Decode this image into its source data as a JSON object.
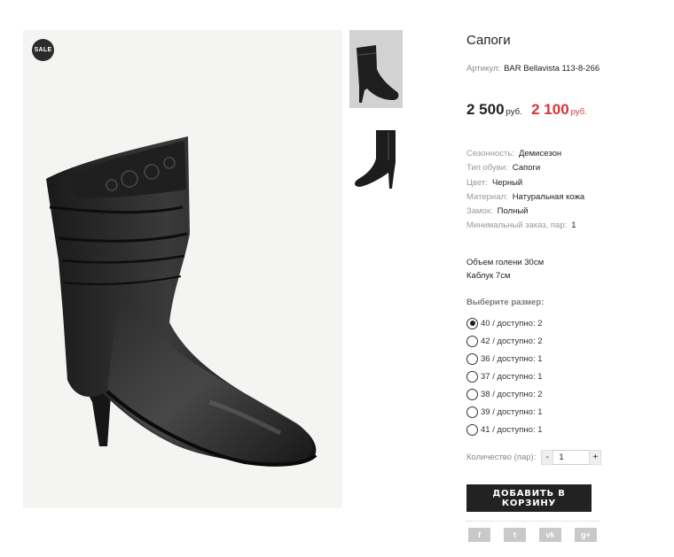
{
  "product": {
    "sale_badge": "SALE",
    "title": "Сапоги",
    "sku_label": "Артикул:",
    "sku_value": "BAR Bellavista 113-8-266",
    "price_old": "2 500",
    "price_old_currency": "руб.",
    "price_new": "2 100",
    "price_new_currency": "руб.",
    "attributes": [
      {
        "key": "Сезонность:",
        "value": "Демисезон"
      },
      {
        "key": "Тип обуви:",
        "value": "Сапоги"
      },
      {
        "key": "Цвет:",
        "value": "Черный"
      },
      {
        "key": "Материал:",
        "value": "Натуральная кожа"
      },
      {
        "key": "Замок:",
        "value": "Полный"
      },
      {
        "key": "Минимальный заказ, пар:",
        "value": "1"
      }
    ],
    "description_lines": [
      "Объем голени 30см",
      "Каблук 7см"
    ]
  },
  "sizes": {
    "heading": "Выберите размер:",
    "selected_index": 0,
    "options": [
      "40 / доступно: 2",
      "42 / доступно: 2",
      "36 / доступно: 1",
      "37 / доступно: 1",
      "38 / доступно: 2",
      "39 / доступно: 1",
      "41 / доступно: 1"
    ]
  },
  "quantity": {
    "label": "Количество (пар):",
    "minus": "-",
    "plus": "+",
    "value": "1"
  },
  "cart_button": "ДОБАВИТЬ В КОРЗИНУ",
  "share": [
    {
      "icon": "facebook-icon",
      "glyph": "f"
    },
    {
      "icon": "twitter-icon",
      "glyph": "t"
    },
    {
      "icon": "vk-icon",
      "glyph": "vk"
    },
    {
      "icon": "google-plus-icon",
      "glyph": "g+"
    }
  ],
  "colors": {
    "price_sale": "#d9343b",
    "button": "#222222",
    "share_icon": "#c9c9c9"
  }
}
